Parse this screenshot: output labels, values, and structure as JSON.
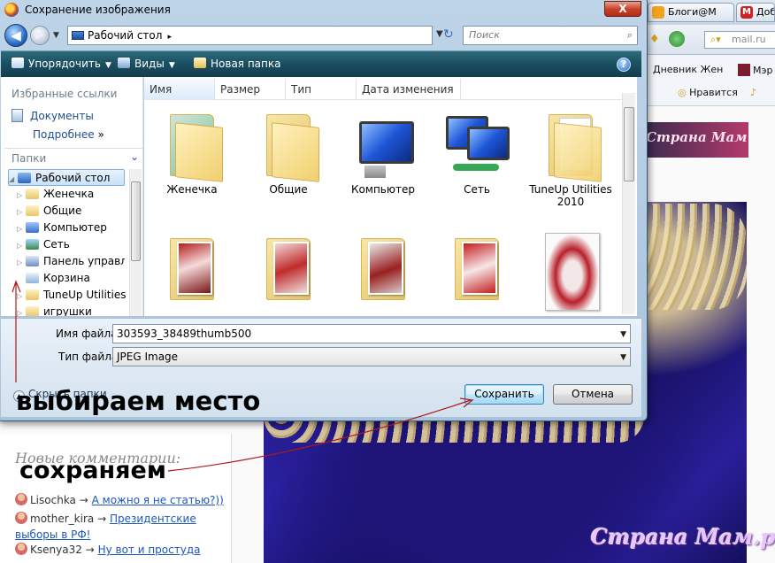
{
  "background": {
    "tabs": [
      {
        "label": "Блоги@М",
        "icon": "mail-ru-icon",
        "color": "#f3a21c"
      },
      {
        "label": "Доб",
        "icon": "m-icon",
        "color": "#cc2222"
      }
    ],
    "search_placeholder": "mail.ru",
    "bookmarks": [
      "Дневник Жен",
      "Мэр",
      "Нравится"
    ],
    "site_banner": "Страна Мам",
    "watermark": "Страна Мам.ру",
    "comments_title": "Новые комментарии:",
    "comments": [
      {
        "user": "Lisochka",
        "arrow": "→",
        "link": "А можно я не статью?))"
      },
      {
        "user": "mother_kira",
        "arrow": "→",
        "link": "Президентские выборы в РФ!"
      },
      {
        "user": "Ksenya32",
        "arrow": "→",
        "link": "Ну вот и простуда"
      }
    ]
  },
  "dialog": {
    "title": "Сохранение изображения",
    "close_label": "X",
    "address": {
      "location": "Рабочий стол",
      "separator": "▸",
      "search_placeholder": "Поиск"
    },
    "toolbar": {
      "organize": "Упорядочить",
      "views": "Виды",
      "new_folder": "Новая папка",
      "help": "?"
    },
    "nav": {
      "favorites_header": "Избранные ссылки",
      "documents": "Документы",
      "more": "Подробнее",
      "more_arrow": "»",
      "folders_header": "Папки",
      "collapse_arrow": "⌄",
      "tree": [
        {
          "label": "Рабочий стол",
          "expander": "◢",
          "icon": "desktop-icon",
          "color": "#2a63c2"
        },
        {
          "label": "Женечка",
          "expander": "▷",
          "icon": "user-folder-icon",
          "color": "#e8c66a"
        },
        {
          "label": "Общие",
          "expander": "▷",
          "icon": "folder-icon",
          "color": "#e8c66a"
        },
        {
          "label": "Компьютер",
          "expander": "▷",
          "icon": "computer-icon",
          "color": "#3b6fc9"
        },
        {
          "label": "Сеть",
          "expander": "▷",
          "icon": "network-icon",
          "color": "#3b8a4a"
        },
        {
          "label": "Панель управления",
          "expander": "▷",
          "icon": "control-panel-icon",
          "color": "#6f8fc5"
        },
        {
          "label": "Корзина",
          "expander": "",
          "icon": "recycle-bin-icon",
          "color": "#8fb4d8"
        },
        {
          "label": "TuneUp Utilities",
          "expander": "▷",
          "icon": "folder-icon",
          "color": "#e8c66a"
        },
        {
          "label": "игрушки",
          "expander": "▷",
          "icon": "folder-icon",
          "color": "#e8c66a"
        }
      ]
    },
    "columns": [
      "Имя",
      "Размер",
      "Тип",
      "Дата изменения"
    ],
    "files_row1": [
      {
        "name": "Женечка",
        "kind": "user-folder"
      },
      {
        "name": "Общие",
        "kind": "folder"
      },
      {
        "name": "Компьютер",
        "kind": "computer"
      },
      {
        "name": "Сеть",
        "kind": "network"
      },
      {
        "name": "TuneUp Utilities 2010",
        "kind": "folder"
      }
    ],
    "files_row2": [
      {
        "name": "",
        "kind": "photo-folder"
      },
      {
        "name": "",
        "kind": "photo-folder"
      },
      {
        "name": "",
        "kind": "photo-folder"
      },
      {
        "name": "",
        "kind": "photo-folder"
      },
      {
        "name": "",
        "kind": "image"
      }
    ],
    "filename_label": "Имя файла:",
    "filename_value": "303593_38489thumb500",
    "filetype_label": "Тип файла:",
    "filetype_value": "JPEG Image",
    "hide_folders": "Скрыть папки",
    "save_button": "Сохранить",
    "cancel_button": "Отмена"
  },
  "annotations": {
    "choose_place": "выбираем место",
    "save": "сохраняем"
  }
}
